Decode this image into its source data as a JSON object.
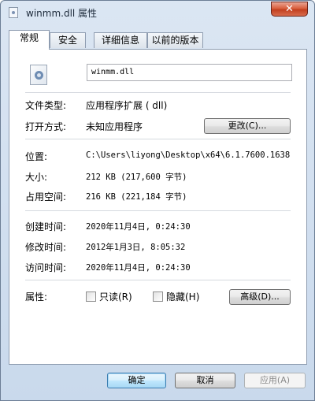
{
  "window": {
    "title": "winmm.dll 属性",
    "close_symbol": "✕"
  },
  "tabs": [
    {
      "label": "常规",
      "active": true
    },
    {
      "label": "安全",
      "active": false
    },
    {
      "label": "详细信息",
      "active": false
    },
    {
      "label": "以前的版本",
      "active": false
    }
  ],
  "general": {
    "file_name": "winmm.dll",
    "file_type": {
      "label": "文件类型:",
      "value": "应用程序扩展 ( dll)"
    },
    "opens_with": {
      "label": "打开方式:",
      "value": "未知应用程序",
      "button": "更改(C)..."
    },
    "location": {
      "label": "位置:",
      "value": "C:\\Users\\liyong\\Desktop\\x64\\6.1.7600.1638"
    },
    "size": {
      "label": "大小:",
      "value": "212 KB (217,600 字节)"
    },
    "size_on_disk": {
      "label": "占用空间:",
      "value": "216 KB (221,184 字节)"
    },
    "created": {
      "label": "创建时间:",
      "value": "2020年11月4日, 0:24:30"
    },
    "modified": {
      "label": "修改时间:",
      "value": "2012年1月3日, 8:05:32"
    },
    "accessed": {
      "label": "访问时间:",
      "value": "2020年11月4日, 0:24:30"
    },
    "attributes": {
      "label": "属性:",
      "readonly": {
        "label": "只读(R)",
        "checked": false
      },
      "hidden": {
        "label": "隐藏(H)",
        "checked": false
      },
      "advanced_button": "高级(D)..."
    }
  },
  "footer": {
    "ok": "确定",
    "cancel": "取消",
    "apply": "应用(A)"
  },
  "icons": {
    "app": "dll-file-icon",
    "file": "dll-gear-icon"
  }
}
